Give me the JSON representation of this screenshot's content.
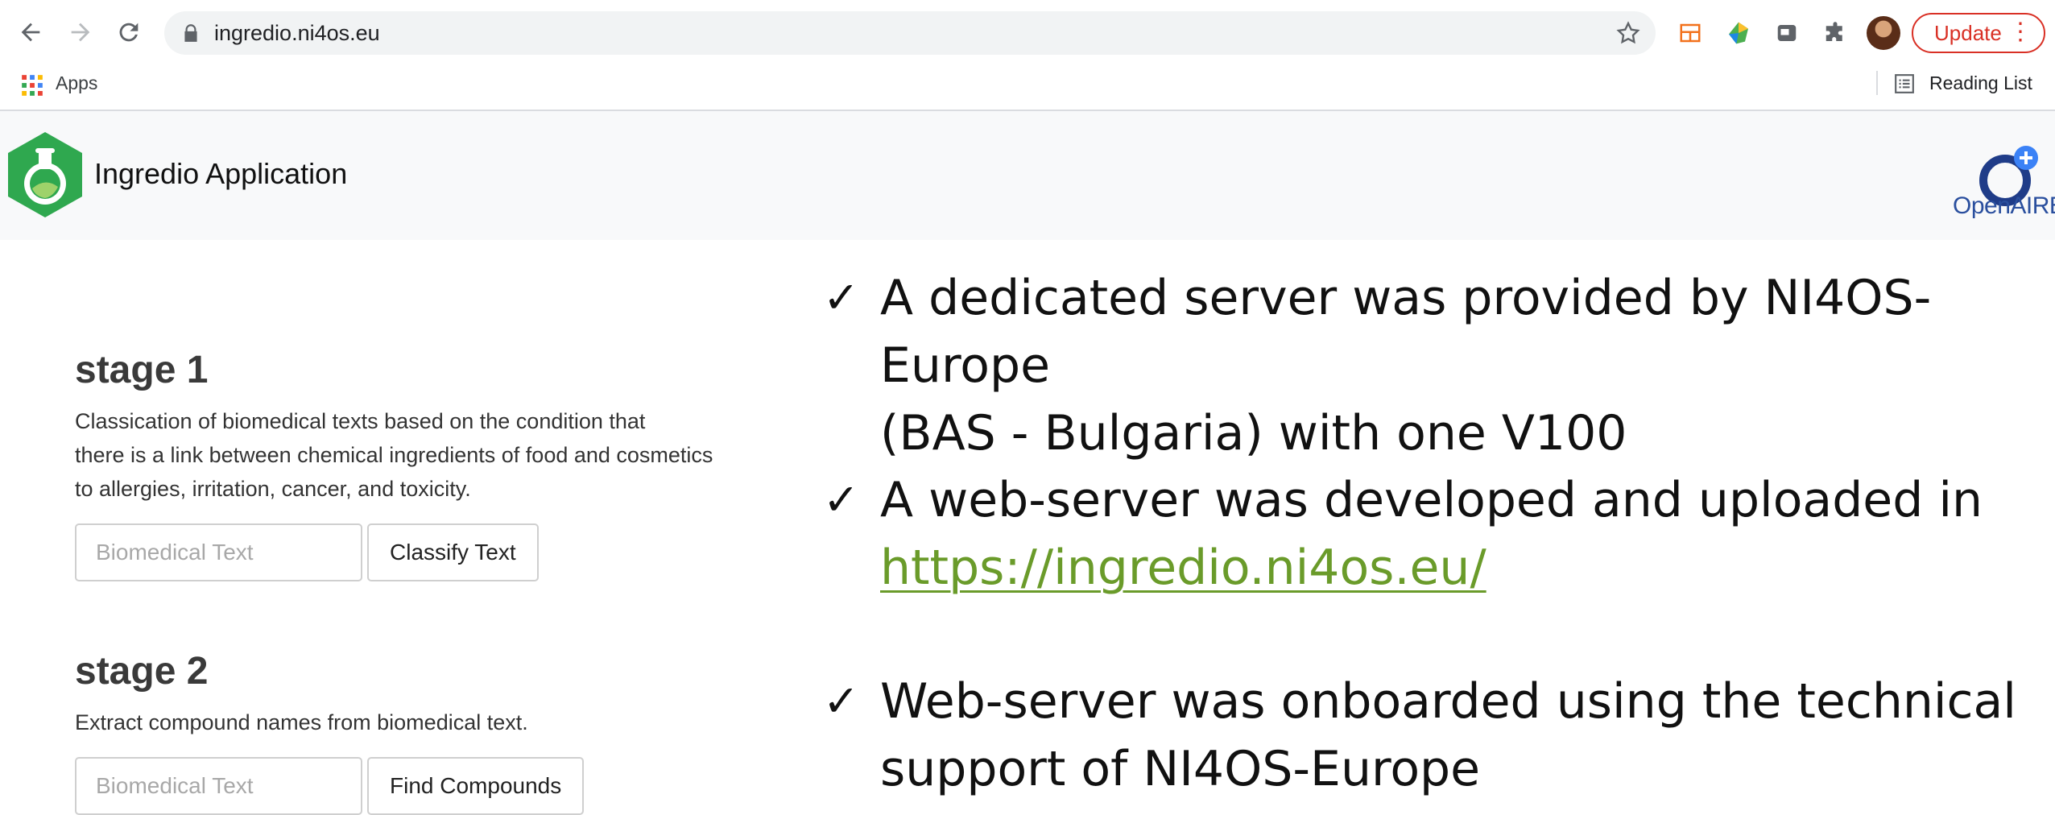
{
  "browser": {
    "url": "ingredio.ni4os.eu",
    "update_label": "Update",
    "bookmarks": {
      "apps_label": "Apps",
      "reading_list_label": "Reading List"
    }
  },
  "app": {
    "title": "Ingredio Application",
    "partner_logo_text": "OpenAIRE",
    "stages": [
      {
        "title": "stage 1",
        "description_lines": [
          "Classication of biomedical texts based on the condition that",
          "there is a link between chemical ingredients of food and cosmetics",
          "to allergies, irritation, cancer, and toxicity."
        ],
        "input_placeholder": "Biomedical Text",
        "button_label": "Classify Text"
      },
      {
        "title": "stage 2",
        "description_lines": [
          "Extract compound names from biomedical text."
        ],
        "input_placeholder": "Biomedical Text",
        "button_label": "Find Compounds"
      }
    ]
  },
  "slide": {
    "check_glyph": "✓",
    "bullets": [
      {
        "lines": [
          "A dedicated server was provided by NI4OS-Europe",
          "(BAS - Bulgaria) with one V100"
        ]
      },
      {
        "line1": "A web-server was developed and uploaded  in",
        "link": "https://ingredio.ni4os.eu/"
      },
      {
        "lines": [
          "Web-server was onboarded using the technical",
          "support of NI4OS-Europe"
        ]
      }
    ]
  },
  "colors": {
    "update_red": "#d93025",
    "link_green": "#6a9b2a",
    "logo_green": "#2fa84f",
    "openaire_blue": "#2a4f9e"
  }
}
